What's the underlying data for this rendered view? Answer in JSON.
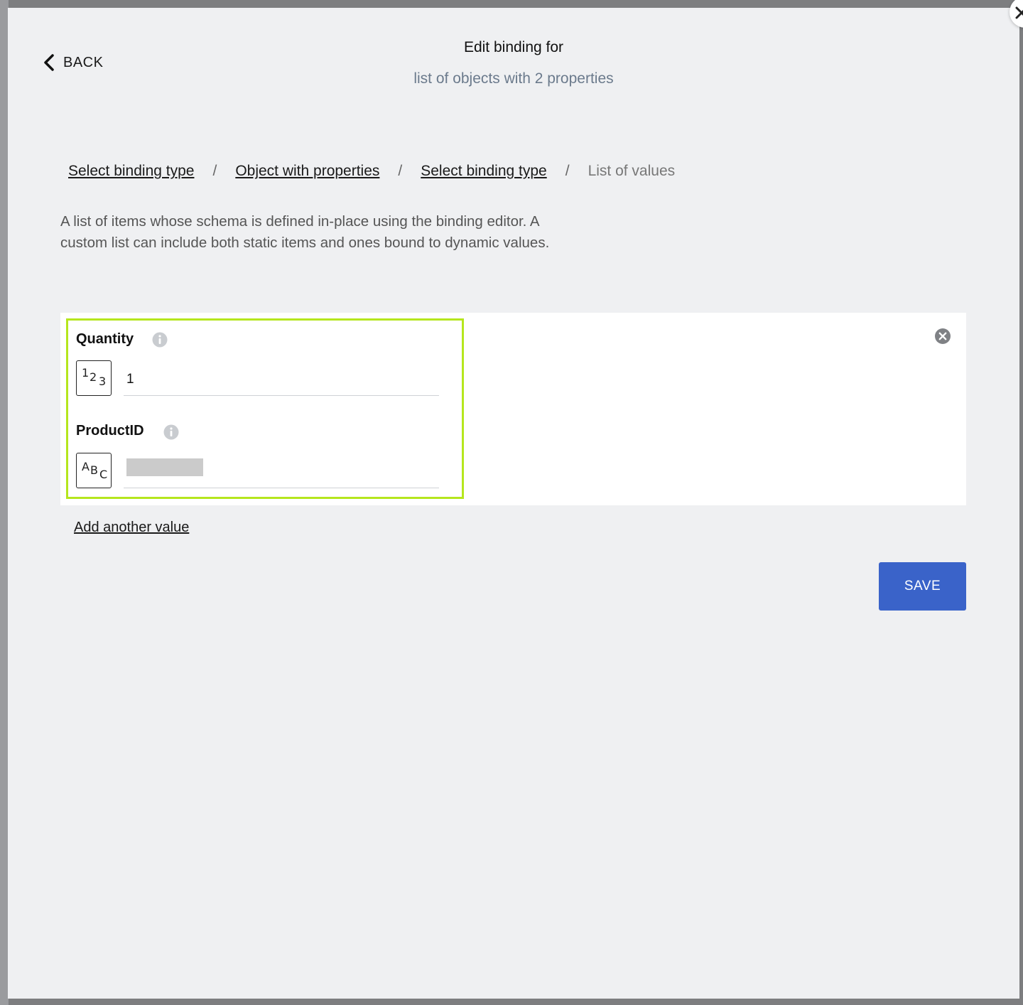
{
  "header": {
    "back_label": "BACK",
    "title": "Edit binding for",
    "subtitle": "list of objects with 2 properties"
  },
  "breadcrumb": {
    "items": [
      {
        "label": "Select binding type",
        "link": true
      },
      {
        "label": "Object with properties",
        "link": true
      },
      {
        "label": "Select binding type",
        "link": true
      },
      {
        "label": "List of values",
        "link": false
      }
    ],
    "separator": "/"
  },
  "description": "A list of items whose schema is defined in-place using the binding editor. A custom list can include both static items and ones bound to dynamic values.",
  "list_item": {
    "fields": [
      {
        "label": "Quantity",
        "type_icon": "number-type-icon",
        "type_glyph": "123",
        "value": "1"
      },
      {
        "label": "ProductID",
        "type_icon": "text-type-icon",
        "type_glyph": "ABC",
        "value": ""
      }
    ],
    "highlight_color": "#b5e61d"
  },
  "actions": {
    "add_value_label": "Add another value",
    "save_label": "SAVE"
  },
  "colors": {
    "accent": "#3a63c9",
    "modal_bg": "#eff0f2",
    "subtitle": "#6b7a8c"
  }
}
